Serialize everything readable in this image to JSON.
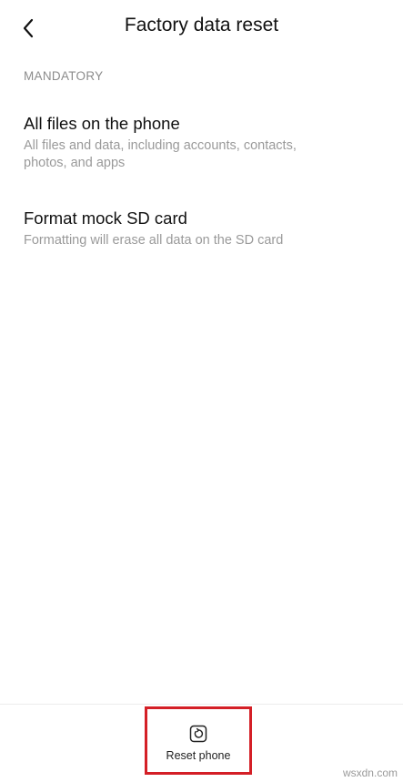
{
  "header": {
    "title": "Factory data reset",
    "back_icon": "chevron-left-icon"
  },
  "section": {
    "label": "MANDATORY"
  },
  "options": [
    {
      "title": "All files on the phone",
      "description": "All files and data, including accounts, contacts, photos, and apps"
    },
    {
      "title": "Format mock SD card",
      "description": "Formatting will erase all data on the SD card"
    }
  ],
  "bottom_bar": {
    "reset_label": "Reset phone",
    "reset_icon": "reset-icon",
    "highlight_color": "#d41f26"
  },
  "watermark": "wsxdn.com"
}
